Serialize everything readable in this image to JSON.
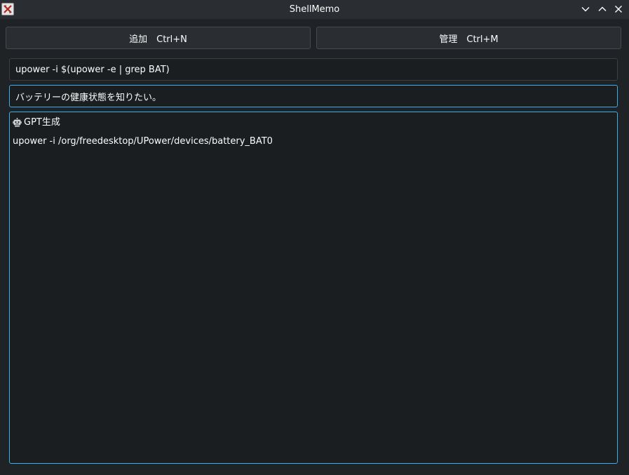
{
  "window": {
    "title": "ShellMemo"
  },
  "toolbar": {
    "add_label": "追加　Ctrl+N",
    "manage_label": "管理　Ctrl+M"
  },
  "form": {
    "command_value": "upower -i $(upower -e | grep BAT)",
    "description_value": "バッテリーの健康状態を知りたい。"
  },
  "memo": {
    "header_icon": "robot-icon",
    "header_label": "GPT生成",
    "body_line": "upower -i /org/freedesktop/UPower/devices/battery_BAT0"
  },
  "colors": {
    "accent": "#3daee9",
    "background": "#202326",
    "field_background": "#1b1e20"
  }
}
